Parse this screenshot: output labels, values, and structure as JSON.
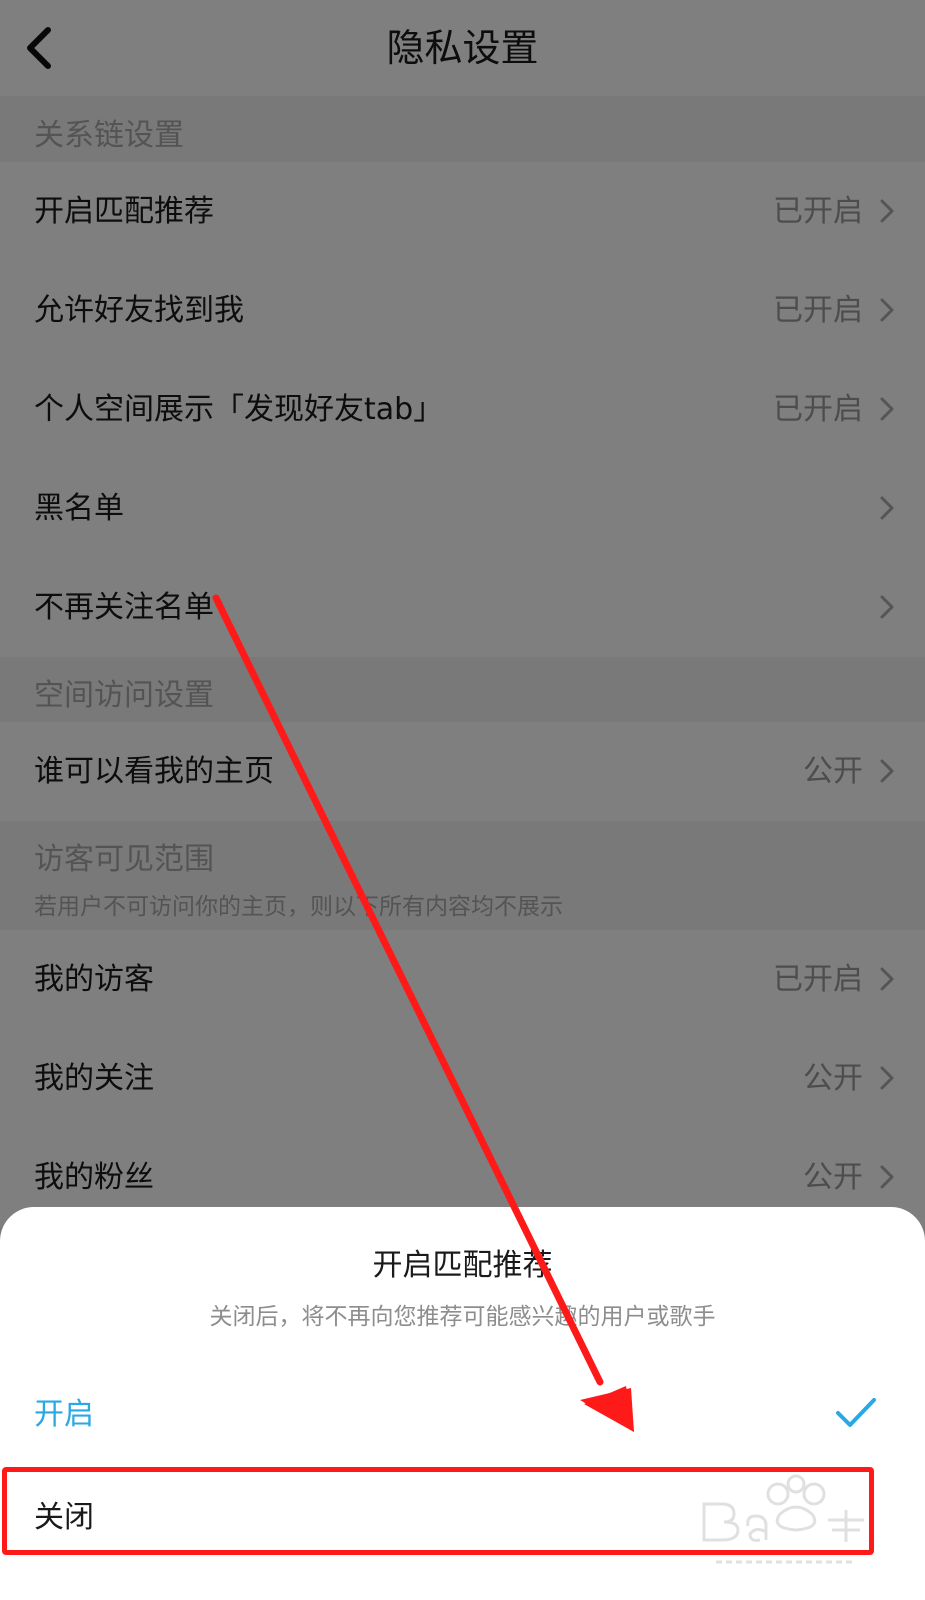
{
  "header": {
    "title": "隐私设置"
  },
  "sections": {
    "relation": {
      "title": "关系链设置",
      "rows": [
        {
          "label": "开启匹配推荐",
          "value": "已开启"
        },
        {
          "label": "允许好友找到我",
          "value": "已开启"
        },
        {
          "label": "个人空间展示「发现好友tab」",
          "value": "已开启"
        },
        {
          "label": "黑名单",
          "value": ""
        },
        {
          "label": "不再关注名单",
          "value": ""
        }
      ]
    },
    "space": {
      "title": "空间访问设置",
      "rows": [
        {
          "label": "谁可以看我的主页",
          "value": "公开"
        }
      ]
    },
    "visitor": {
      "title": "访客可见范围",
      "subtitle": "若用户不可访问你的主页，则以下所有内容均不展示",
      "rows": [
        {
          "label": "我的访客",
          "value": "已开启"
        },
        {
          "label": "我的关注",
          "value": "公开"
        },
        {
          "label": "我的粉丝",
          "value": "公开"
        }
      ]
    }
  },
  "sheet": {
    "title": "开启匹配推荐",
    "description": "关闭后，将不再向您推荐可能感兴趣的用户或歌手",
    "options": [
      {
        "label": "开启",
        "selected": true
      },
      {
        "label": "关闭",
        "selected": false
      }
    ]
  },
  "annotation": {
    "color": "#ff1a1a"
  },
  "colors": {
    "accent": "#29a8e6"
  },
  "icons": {
    "back": "chevron-left-icon",
    "row": "chevron-right-icon",
    "selected": "checkmark-icon"
  }
}
